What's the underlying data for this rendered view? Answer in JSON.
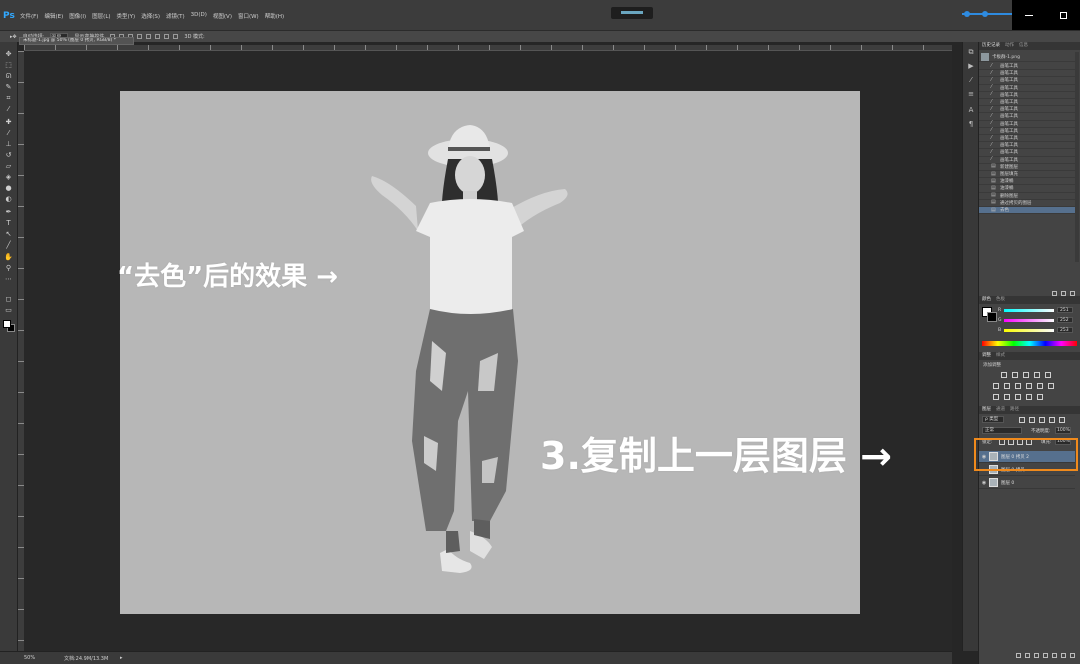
{
  "app": {
    "logo": "Ps"
  },
  "menu": [
    "文件(F)",
    "编辑(E)",
    "图像(I)",
    "图层(L)",
    "类型(Y)",
    "选择(S)",
    "滤镜(T)",
    "3D(D)",
    "视图(V)",
    "窗口(W)",
    "帮助(H)"
  ],
  "options_bar": {
    "auto_select": "自动选择:",
    "auto_select_value": "图层",
    "show_transform": "显示变换控件",
    "mode_3d": "3D 模式:"
  },
  "document": {
    "tab_title": "未标题-1.jpg @ 50% (图层 0 拷贝, RGB/8) *"
  },
  "annotations": {
    "desaturate": "“去色”后的效果 →",
    "duplicate_layer": "3.复制上一层图层 →"
  },
  "status": {
    "zoom": "50%",
    "doc_size": "文档:24.9M/13.3M"
  },
  "history": {
    "tabs": [
      "历史记录",
      "动作",
      "信息"
    ],
    "snapshot": "卡板群-1.png",
    "items": [
      "画笔工具",
      "画笔工具",
      "画笔工具",
      "画笔工具",
      "画笔工具",
      "画笔工具",
      "画笔工具",
      "画笔工具",
      "画笔工具",
      "画笔工具",
      "画笔工具",
      "画笔工具",
      "画笔工具",
      "画笔工具",
      "新建图层",
      "图层填充",
      "油漆桶",
      "油漆桶",
      "删除图层",
      "通过拷贝的图层",
      "去色"
    ],
    "selected_index": 20
  },
  "color": {
    "tabs": [
      "颜色",
      "色板"
    ],
    "channels": [
      {
        "label": "R",
        "value": "251"
      },
      {
        "label": "G",
        "value": "252"
      },
      {
        "label": "B",
        "value": "253"
      }
    ]
  },
  "adjustments": {
    "tabs": [
      "调整",
      "样式"
    ],
    "title": "添加调整"
  },
  "layers": {
    "tabs": [
      "图层",
      "通道",
      "路径"
    ],
    "filter": "ρ 类型",
    "blend_mode": "正常",
    "opacity_label": "不透明度:",
    "opacity": "100%",
    "lock_label": "锁定:",
    "fill_label": "填充:",
    "fill": "100%",
    "items": [
      {
        "name": "图层 0 拷贝 2",
        "selected": true
      },
      {
        "name": "图层 0 拷贝",
        "selected": false
      },
      {
        "name": "图层 0",
        "selected": false
      }
    ]
  }
}
